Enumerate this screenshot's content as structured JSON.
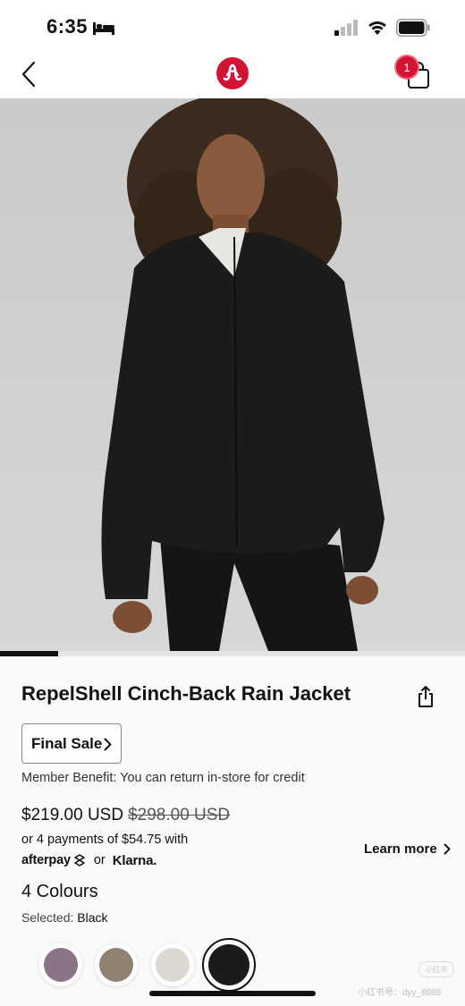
{
  "status_bar": {
    "time": "6:35",
    "icons": [
      "bed-icon",
      "cellular-signal-icon",
      "wifi-icon",
      "battery-icon"
    ]
  },
  "nav": {
    "back_icon": "chevron-left-icon",
    "logo_icon": "lululemon-logo",
    "cart_icon": "shopping-bag-icon",
    "cart_count": "1"
  },
  "gallery": {
    "image": "woman-in-black-rain-jacket-photo",
    "progress": 0.125
  },
  "product": {
    "title": "RepelShell Cinch-Back Rain Jacket",
    "share_icon": "share-icon",
    "final_sale_label": "Final Sale",
    "member_benefit": "Member Benefit: You can return in-store for credit",
    "price_current": "$219.00 USD",
    "price_original": "$298.00 USD",
    "installments": "or 4 payments of $54.75 with",
    "afterpay": "afterpay",
    "or": "or",
    "klarna": "Klarna.",
    "learn_more": "Learn more",
    "colours_count": "4 Colours",
    "selected_label": "Selected:",
    "selected_value": "Black"
  },
  "swatches": [
    {
      "color": "#8a7489"
    },
    {
      "color": "#8f8273"
    },
    {
      "color": "#dcd8d1"
    },
    {
      "color": "#1b1b1b",
      "selected": true
    }
  ],
  "watermark": {
    "badge": "小红书",
    "text": "小红书号：dyy_8888"
  },
  "colors": {
    "brand_red": "#d31334",
    "text": "#111111"
  }
}
